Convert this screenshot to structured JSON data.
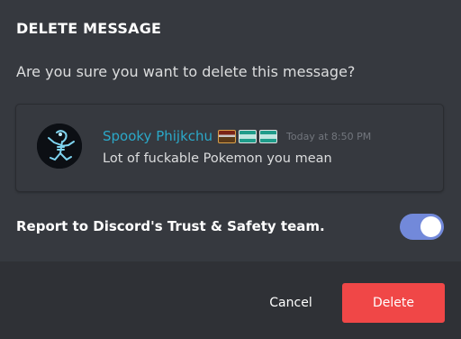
{
  "modal": {
    "title": "DELETE MESSAGE",
    "question": "Are you sure you want to delete this message?"
  },
  "message": {
    "username": "Spooky Phijkchu",
    "username_color": "#2ba8c8",
    "emotes": [
      "train-emote-icon",
      "screen-emote-icon",
      "screen-emote-icon"
    ],
    "timestamp": "Today at 8:50 PM",
    "content": "Lot of fuckable Pokemon you mean",
    "avatar_icon": "frog-skeleton-avatar"
  },
  "report": {
    "label": "Report to Discord's Trust & Safety team.",
    "enabled": true,
    "toggle_color": "#7289da"
  },
  "footer": {
    "cancel_label": "Cancel",
    "delete_label": "Delete",
    "delete_color": "#f04747"
  }
}
